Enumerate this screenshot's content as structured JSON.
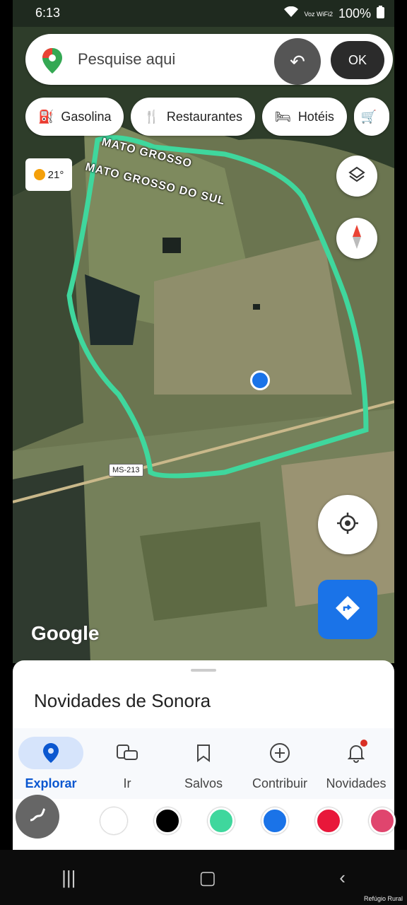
{
  "status": {
    "time": "6:13",
    "network": "Voz WiFi2",
    "battery": "100%"
  },
  "search": {
    "placeholder": "Pesquise aqui",
    "ok_label": "OK"
  },
  "chips": [
    {
      "label": "Gasolina",
      "icon": "gas-station-icon"
    },
    {
      "label": "Restaurantes",
      "icon": "restaurant-icon"
    },
    {
      "label": "Hotéis",
      "icon": "hotel-icon"
    }
  ],
  "weather": {
    "temp": "21°"
  },
  "map": {
    "labels": [
      "MATO GROSSO",
      "MATO GROSSO DO SUL"
    ],
    "road": "MS-213",
    "logo": "Google",
    "outline_color": "#3fd79d",
    "location_color": "#1a73e8"
  },
  "sheet": {
    "title": "Novidades de Sonora"
  },
  "nav": [
    {
      "label": "Explorar",
      "icon": "pin-icon",
      "active": true
    },
    {
      "label": "Ir",
      "icon": "commute-icon"
    },
    {
      "label": "Salvos",
      "icon": "bookmark-icon"
    },
    {
      "label": "Contribuir",
      "icon": "add-circle-icon"
    },
    {
      "label": "Novidades",
      "icon": "bell-icon"
    }
  ],
  "draw_colors": [
    "#ffffff",
    "#000000",
    "#3fd79d",
    "#1a73e8",
    "#e8173a",
    "#e0456e"
  ],
  "watermark": "Refúgio Rural"
}
